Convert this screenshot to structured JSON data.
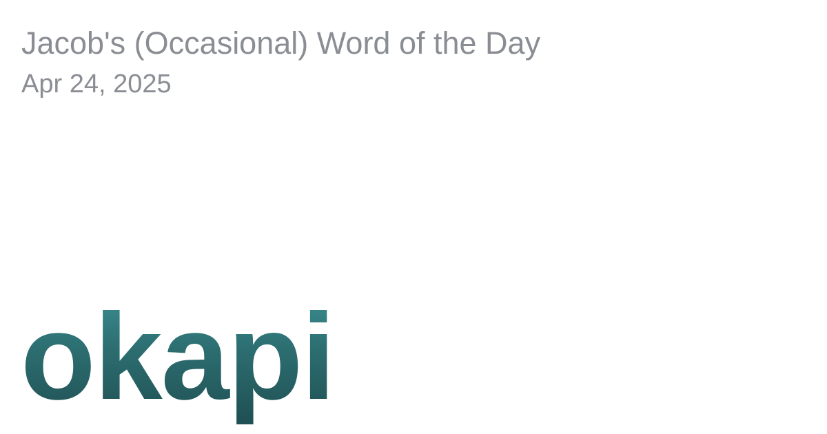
{
  "header": {
    "site_title": "Jacob's (Occasional) Word of the Day",
    "date": "Apr 24, 2025"
  },
  "main": {
    "word": "okapi"
  },
  "colors": {
    "meta_text": "#8a8d93",
    "word_gradient_top": "#3c9094",
    "word_gradient_bottom": "#1f4f52"
  }
}
